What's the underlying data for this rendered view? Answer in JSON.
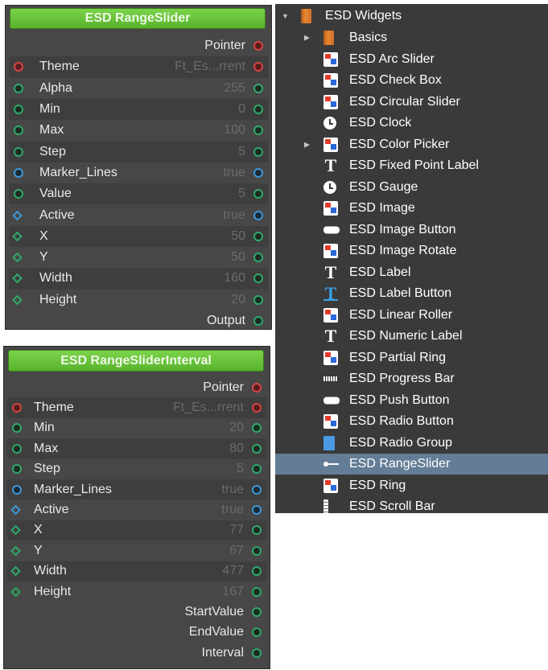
{
  "node1": {
    "title": "ESD RangeSlider",
    "top_output": "Pointer",
    "props": [
      {
        "label": "Theme",
        "value": "Ft_Es...rrent",
        "in": "red-circle",
        "out": "red-circle"
      },
      {
        "label": "Alpha",
        "value": "255",
        "in": "green-circle",
        "out": "green-circle"
      },
      {
        "label": "Min",
        "value": "0",
        "in": "green-circle",
        "out": "green-circle"
      },
      {
        "label": "Max",
        "value": "100",
        "in": "green-circle",
        "out": "green-circle"
      },
      {
        "label": "Step",
        "value": "5",
        "in": "green-circle",
        "out": "green-circle"
      },
      {
        "label": "Marker_Lines",
        "value": "true",
        "in": "blue-circle",
        "out": "blue-circle"
      },
      {
        "label": "Value",
        "value": "5",
        "in": "green-circle",
        "out": "green-circle"
      },
      {
        "label": "Active",
        "value": "true",
        "in": "blue-diamond",
        "out": "blue-circle"
      },
      {
        "label": "X",
        "value": "50",
        "in": "green-diamond",
        "out": "green-circle"
      },
      {
        "label": "Y",
        "value": "50",
        "in": "green-diamond",
        "out": "green-circle"
      },
      {
        "label": "Width",
        "value": "160",
        "in": "green-diamond",
        "out": "green-circle"
      },
      {
        "label": "Height",
        "value": "20",
        "in": "green-diamond",
        "out": "green-circle"
      }
    ],
    "bottom_outputs": [
      "Output"
    ]
  },
  "node2": {
    "title": "ESD RangeSliderInterval",
    "top_output": "Pointer",
    "props": [
      {
        "label": "Theme",
        "value": "Ft_Es...rrent",
        "in": "red-circle",
        "out": "red-circle"
      },
      {
        "label": "Min",
        "value": "20",
        "in": "green-circle",
        "out": "green-circle"
      },
      {
        "label": "Max",
        "value": "80",
        "in": "green-circle",
        "out": "green-circle"
      },
      {
        "label": "Step",
        "value": "5",
        "in": "green-circle",
        "out": "green-circle"
      },
      {
        "label": "Marker_Lines",
        "value": "true",
        "in": "blue-circle",
        "out": "blue-circle"
      },
      {
        "label": "Active",
        "value": "true",
        "in": "blue-diamond",
        "out": "blue-circle"
      },
      {
        "label": "X",
        "value": "77",
        "in": "green-diamond",
        "out": "green-circle"
      },
      {
        "label": "Y",
        "value": "67",
        "in": "green-diamond",
        "out": "green-circle"
      },
      {
        "label": "Width",
        "value": "477",
        "in": "green-diamond",
        "out": "green-circle"
      },
      {
        "label": "Height",
        "value": "167",
        "in": "green-diamond",
        "out": "green-circle"
      }
    ],
    "bottom_outputs": [
      "StartValue",
      "EndValue",
      "Interval"
    ]
  },
  "tree": {
    "root": {
      "label": "ESD Widgets",
      "icon": "book-icon",
      "expanded": true
    },
    "items": [
      {
        "label": "Basics",
        "icon": "book-icon",
        "expandable": true
      },
      {
        "label": "ESD Arc Slider",
        "icon": "widget-icon"
      },
      {
        "label": "ESD Check Box",
        "icon": "widget-icon"
      },
      {
        "label": "ESD Circular Slider",
        "icon": "widget-icon"
      },
      {
        "label": "ESD Clock",
        "icon": "clock-icon"
      },
      {
        "label": "ESD Color Picker",
        "icon": "widget-icon",
        "expandable": true
      },
      {
        "label": "ESD Fixed Point Label",
        "icon": "text-icon"
      },
      {
        "label": "ESD Gauge",
        "icon": "clock-icon"
      },
      {
        "label": "ESD Image",
        "icon": "widget-icon"
      },
      {
        "label": "ESD Image Button",
        "icon": "button-icon"
      },
      {
        "label": "ESD Image Rotate",
        "icon": "widget-icon"
      },
      {
        "label": "ESD Label",
        "icon": "text-icon"
      },
      {
        "label": "ESD Label Button",
        "icon": "text-button-icon"
      },
      {
        "label": "ESD Linear Roller",
        "icon": "widget-icon"
      },
      {
        "label": "ESD Numeric Label",
        "icon": "text-icon"
      },
      {
        "label": "ESD Partial Ring",
        "icon": "widget-icon"
      },
      {
        "label": "ESD Progress Bar",
        "icon": "progress-bar-icon"
      },
      {
        "label": "ESD Push Button",
        "icon": "button-icon"
      },
      {
        "label": "ESD Radio Button",
        "icon": "widget-icon"
      },
      {
        "label": "ESD Radio Group",
        "icon": "document-icon"
      },
      {
        "label": "ESD RangeSlider",
        "icon": "range-slider-icon",
        "selected": true
      },
      {
        "label": "ESD Ring",
        "icon": "widget-icon"
      },
      {
        "label": "ESD Scroll Bar",
        "icon": "scrollbar-icon"
      }
    ]
  }
}
